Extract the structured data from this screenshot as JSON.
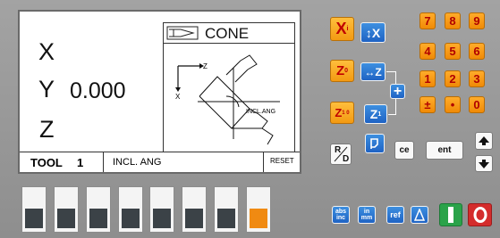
{
  "display": {
    "axes": [
      {
        "label": "X",
        "value": ""
      },
      {
        "label": "Y",
        "value": "0.000"
      },
      {
        "label": "Z",
        "value": ""
      }
    ],
    "mode_title": "CONE",
    "diagram": {
      "z_label": "Z",
      "x_label": "X",
      "angle_label": "INCL.ANG"
    },
    "status": {
      "tool_label": "TOOL",
      "tool_number": "1",
      "field": "INCL. ANG",
      "reset_label": "RESET"
    }
  },
  "keys": {
    "xi": "X",
    "xi_sub": "i",
    "zero": "Z",
    "zero_sub": "0",
    "z10": "Z",
    "z10_sub": "1 0",
    "ix": "↕X",
    "iz": "↔Z",
    "z1": "Z",
    "z1_sub": "1",
    "plus": "+",
    "rd_top": "R",
    "rd_bottom": "D",
    "ce": "ce",
    "ent": "ent",
    "abs_inc": "abs inc",
    "in_mm": "in mm",
    "ref": "ref"
  },
  "numpad": [
    "7",
    "8",
    "9",
    "4",
    "5",
    "6",
    "1",
    "2",
    "3",
    "±",
    "•",
    "0"
  ],
  "softkeys": {
    "count": 8,
    "lit_index": 7
  },
  "colors": {
    "yellow": "#f5a21a",
    "blue": "#2169c8",
    "green": "#2aa34a",
    "red": "#d42c2c",
    "lamp_on": "#f08a12"
  }
}
